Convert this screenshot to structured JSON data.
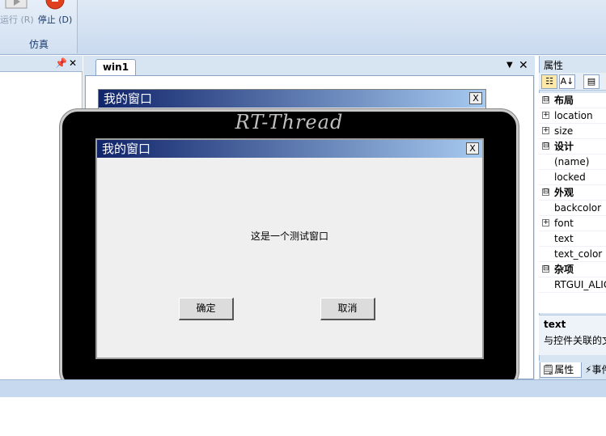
{
  "ribbon": {
    "run_label": "运行 (R)",
    "stop_label": "停止 (D)",
    "group_label": "仿真"
  },
  "left_pane": {
    "pin_icon": "pin-icon",
    "close_icon": "close-icon"
  },
  "document": {
    "tab_label": "win1"
  },
  "design_window": {
    "title": "我的窗口",
    "close_glyph": "X"
  },
  "device": {
    "brand": "RT-Thread"
  },
  "preview_window": {
    "title": "我的窗口",
    "close_glyph": "X",
    "message": "这是一个测试窗口",
    "ok_label": "确定",
    "cancel_label": "取消"
  },
  "properties": {
    "title": "属性",
    "rows": [
      {
        "kind": "category",
        "expander": "⊟",
        "label": "布局"
      },
      {
        "kind": "item",
        "expander": "+",
        "label": "location"
      },
      {
        "kind": "item",
        "expander": "+",
        "label": "size"
      },
      {
        "kind": "category",
        "expander": "⊟",
        "label": "设计"
      },
      {
        "kind": "item",
        "expander": "",
        "label": "(name)"
      },
      {
        "kind": "item",
        "expander": "",
        "label": "locked"
      },
      {
        "kind": "category",
        "expander": "⊟",
        "label": "外观"
      },
      {
        "kind": "item",
        "expander": "",
        "label": "backcolor"
      },
      {
        "kind": "item",
        "expander": "+",
        "label": "font"
      },
      {
        "kind": "item",
        "expander": "",
        "label": "text"
      },
      {
        "kind": "item",
        "expander": "",
        "label": "text_color"
      },
      {
        "kind": "category",
        "expander": "⊟",
        "label": "杂项"
      },
      {
        "kind": "item",
        "expander": "",
        "label": "RTGUI_ALIGN"
      }
    ],
    "desc_title": "text",
    "desc_text": "与控件关联的文本",
    "tab_props": "属性",
    "tab_events": "事件"
  }
}
